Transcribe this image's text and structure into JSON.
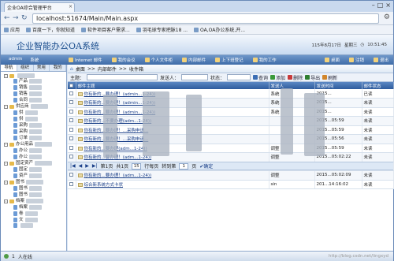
{
  "browser": {
    "tab_title": "企业OA综合管理平台",
    "tab_close": "×",
    "window_buttons": [
      "–",
      "□",
      "×"
    ],
    "nav": {
      "back": "←",
      "forward": "→",
      "reload": "↻"
    },
    "url": "localhost:51674/Main/Main.aspx",
    "wrench_icon": "⚙",
    "bookmarks": [
      "应用",
      "百度一下，你就知道",
      "软件项目客户需求...",
      "羽毛球专家把脉18 ...",
      "OA,OA办公系统,开..."
    ]
  },
  "app": {
    "title": "企业智能办公OA系统",
    "date": "115年8月17日",
    "weekday": "星期三",
    "time": "10:51:45",
    "menu_user": [
      "admin",
      "系统"
    ],
    "menu_items": [
      "Internet 邮件",
      "我的会议",
      "个人文件柜",
      "内部邮件",
      "上下班登记",
      "我的工作"
    ],
    "menu_right": [
      "桌面",
      "注销",
      "退出"
    ]
  },
  "sidebar": {
    "tabs": [
      "导航",
      "组织",
      "常用",
      "我的"
    ],
    "tree": [
      {
        "level": 1,
        "type": "folder",
        "label": "",
        "expand": "-"
      },
      {
        "level": 2,
        "type": "doc",
        "label": "产品"
      },
      {
        "level": 2,
        "type": "doc",
        "label": "销售"
      },
      {
        "level": 2,
        "type": "doc",
        "label": "销售"
      },
      {
        "level": 2,
        "type": "doc",
        "label": "合同"
      },
      {
        "level": 1,
        "type": "folder",
        "label": "供应商",
        "expand": "-"
      },
      {
        "level": 2,
        "type": "doc",
        "label": "供"
      },
      {
        "level": 2,
        "type": "doc",
        "label": "供"
      },
      {
        "level": 2,
        "type": "doc",
        "label": "采购"
      },
      {
        "level": 2,
        "type": "doc",
        "label": "采购"
      },
      {
        "level": 2,
        "type": "doc",
        "label": "订单"
      },
      {
        "level": 1,
        "type": "folder",
        "label": "办公用品",
        "expand": "-"
      },
      {
        "level": 2,
        "type": "doc",
        "label": "办公"
      },
      {
        "level": 2,
        "type": "doc",
        "label": "办公"
      },
      {
        "level": 1,
        "type": "folder",
        "label": "固定资产",
        "expand": "-"
      },
      {
        "level": 2,
        "type": "doc",
        "label": "固定"
      },
      {
        "level": 2,
        "type": "doc",
        "label": "资产"
      },
      {
        "level": 1,
        "type": "folder",
        "label": "图书",
        "expand": "-"
      },
      {
        "level": 2,
        "type": "doc",
        "label": "图书"
      },
      {
        "level": 2,
        "type": "doc",
        "label": "图书"
      },
      {
        "level": 1,
        "type": "folder",
        "label": "档案",
        "expand": "-"
      },
      {
        "level": 2,
        "type": "doc",
        "label": "档案"
      },
      {
        "level": 2,
        "type": "doc",
        "label": "卷"
      },
      {
        "level": 2,
        "type": "doc",
        "label": "文"
      },
      {
        "level": 2,
        "type": "doc",
        "label": ""
      }
    ]
  },
  "main": {
    "breadcrumb": [
      "桌面",
      "内部邮件",
      "收件箱"
    ],
    "breadcrumb_sep": ">>",
    "filter": {
      "subject_label": "主题：",
      "sender_label": "发送人：",
      "status_label": "状态：",
      "buttons": [
        "查询",
        "添加",
        "删除",
        "导出",
        "刷新"
      ]
    },
    "columns": [
      "",
      "邮件主题",
      "发送人",
      "发送时间",
      "邮件状态"
    ],
    "rows": [
      {
        "subject": "你有新的...要办理！(admin...1-24))",
        "sender": "系统",
        "time": "2015...",
        "status": "已读"
      },
      {
        "subject": "你有新的...要办理！(admin...1-24))",
        "sender": "系统",
        "time": "2015...",
        "status": "未读"
      },
      {
        "subject": "你有新的...要办理！(admin...1-24))",
        "sender": "系统",
        "time": "2015...",
        "status": "未读"
      },
      {
        "subject": "你有新的...不要办理(adm...1-24))",
        "sender": "",
        "time": "2015...05:59",
        "status": "未读"
      },
      {
        "subject": "你有新的...要办理！...采购申请...",
        "sender": "",
        "time": "2015...05:59",
        "status": "未读"
      },
      {
        "subject": "你有新的...要办理！...采购申请...",
        "sender": "",
        "time": "2015...05:56",
        "status": "未读"
      },
      {
        "subject": "你有新的...要办理(adm...1-24))",
        "sender": "调整",
        "time": "2015...05:59",
        "status": "未读"
      },
      {
        "subject": "你有新的...要办理！(adm...1-24))",
        "sender": "调整",
        "time": "2015...05:02:22",
        "status": "未读"
      },
      {
        "subject": "你有新的...要办理！(admin...办公用品申请...1-24))",
        "sender": "调整",
        "time": "2015...05:02:12",
        "status": "未读"
      },
      {
        "subject": "你有新的...要办理！(adm...1-24))",
        "sender": "调整",
        "time": "2015...05:02:09",
        "status": "未读"
      },
      {
        "subject": "综合新系统方式卡状",
        "sender": "sin",
        "time": "201...14:16:02",
        "status": "未读"
      }
    ],
    "pager": {
      "nav": [
        "|◀",
        "◀",
        "▶",
        "▶|"
      ],
      "page_label": "第1页",
      "total_label": "共1页",
      "page_size": "15",
      "rows_label": "行每页",
      "goto_label": "转到第",
      "goto_value": "1",
      "goto_unit": "页",
      "confirm": "确定"
    }
  },
  "status": {
    "online": "人在线",
    "count": "1",
    "watermark": "http://blog.csdn.net/lingxyd"
  }
}
